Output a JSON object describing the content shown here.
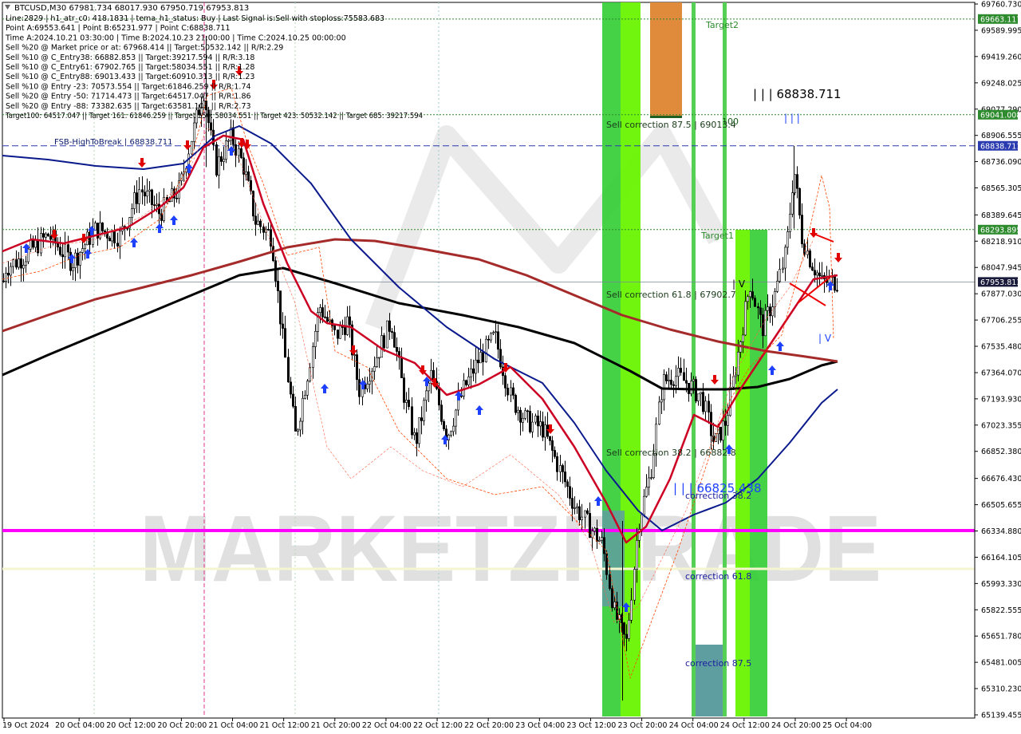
{
  "chart_data": {
    "type": "candlestick",
    "symbol_line": "BTCUSD,M30  67981.734 68017.930 67950.719 67953.813",
    "info_lines": [
      "Line:2829 | h1_atr_c0: 418.1831 | tema_h1_status: Buy | Last Signal is:Sell with stoploss:75583.683",
      "Point A:69553.641 | Point B:65231.977 | Point C:68838.711",
      "Time A:2024.10.21 03:30:00 | Time B:2024.10.23 21:00:00 | Time C:2024.10.25 00:00:00",
      "Sell %20 @ Market price or at: 67968.414 || Target:50532.142 || R/R:2.29",
      "Sell %10 @ C_Entry38: 66882.853 || Target:39217.594 || R/R:3.18",
      "Sell %10 @ C_Entry61: 67902.765 || Target:58034.551 || R/R:1.28",
      "Sell %10 @ C_Entry88: 69013.433 || Target:60910.313 || R/R:1.23",
      "Sell %10 @ Entry -23: 70573.554 || Target:61846.259 || R/R:1.74",
      "Sell %20 @ Entry -50: 71714.473 || Target:64517.047 || R/R:1.86",
      "Sell %20 @ Entry -88: 73382.635 || Target:63581.101 || R/R:2.73",
      "Target100: 64517.047 || Target 161: 61846.259 || Target 250: 58034.551 || Target 423: 50532.142 || Target 685: 39217.594"
    ],
    "y_ticks": [
      "69760.730",
      "69589.995",
      "69419.260",
      "69248.025",
      "69077.290",
      "68906.555",
      "68736.090",
      "68565.305",
      "68389.645",
      "68218.910",
      "68047.945",
      "67877.030",
      "67706.255",
      "67535.480",
      "67364.070",
      "67193.930",
      "67023.355",
      "66852.380",
      "66676.430",
      "66505.655",
      "66334.880",
      "66164.105",
      "65993.330",
      "65822.555",
      "65651.780",
      "65481.005",
      "65310.230",
      "65139.455"
    ],
    "x_ticks": [
      "19 Oct 2024",
      "20 Oct 04:00",
      "20 Oct 12:00",
      "20 Oct 20:00",
      "21 Oct 04:00",
      "21 Oct 12:00",
      "21 Oct 20:00",
      "22 Oct 04:00",
      "22 Oct 12:00",
      "22 Oct 20:00",
      "23 Oct 04:00",
      "23 Oct 12:00",
      "23 Oct 20:00",
      "24 Oct 04:00",
      "24 Oct 12:00",
      "24 Oct 20:00",
      "25 Oct 04:00"
    ],
    "price_tags": [
      {
        "value": 69663.117,
        "label": "69663.117",
        "color": "#2e8b2e"
      },
      {
        "value": 69041.008,
        "label": "69041.008",
        "color": "#2e8b2e"
      },
      {
        "value": 68838.711,
        "label": "68838.711",
        "color": "#2b3bb0"
      },
      {
        "value": 68293.895,
        "label": "68293.895",
        "color": "#2e8b2e"
      },
      {
        "value": 67953.813,
        "label": "67953.813",
        "color": "#1a1a3a"
      }
    ],
    "labels": {
      "fsb": "FSB-HighToBreak | 68838.711",
      "target2": "Target2",
      "target1": "Target1",
      "level_c": "| | | 68838.711",
      "sell_corr_875": "Sell correction 87.5 | 69013.4",
      "sell_corr_618": "Sell correction 61.8 | 67902.7",
      "sell_corr_382": "Sell correction 38.2 | 66882.8",
      "level_b": "| | | 66825.438",
      "corr_382": "correction 38.2",
      "corr_618": "correction 61.8",
      "corr_875": "correction 87.5",
      "hundred": "100",
      "wave3": "| | |",
      "wave4": "| V",
      "wave4b": "| V",
      "watermark": "MARKETZITRADE"
    },
    "colors": {
      "ma_black": "#000000",
      "ma_darkred": "#a52a2a",
      "ma_navy": "#0a1a8c",
      "ma_red": "#cc0022",
      "magenta_line": "#ff00ff",
      "cream_line": "#f5f5d0",
      "green_zone": "#32cd32",
      "lime_zone": "#7cfc00",
      "orange_zone": "#e08a3c",
      "teal_zone": "#5f9ea0"
    }
  }
}
